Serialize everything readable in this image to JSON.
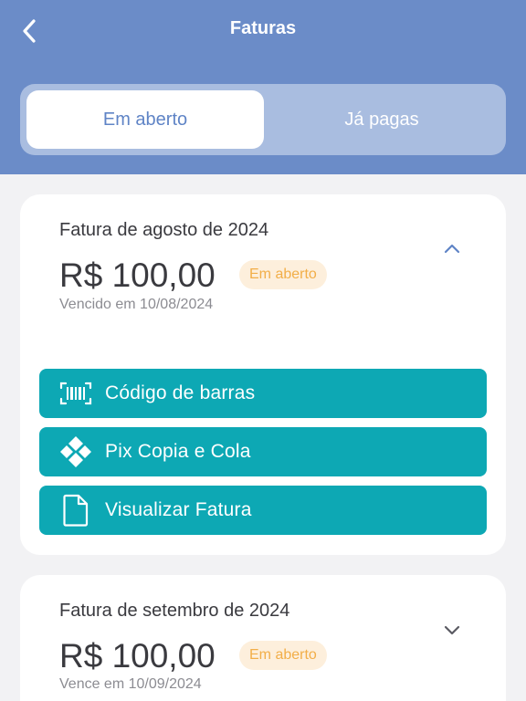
{
  "header": {
    "title": "Faturas",
    "back_icon": "chevron-left-icon"
  },
  "tabs": [
    {
      "label": "Em aberto",
      "active": true
    },
    {
      "label": "Já pagas",
      "active": false
    }
  ],
  "invoices": [
    {
      "title": "Fatura de agosto de 2024",
      "amount": "R$ 100,00",
      "status": "Em aberto",
      "due": "Vencido em 10/08/2024",
      "expanded": true,
      "chevron_icon": "chevron-up-icon",
      "actions": [
        {
          "label": "Código de barras",
          "icon": "barcode-icon"
        },
        {
          "label": "Pix Copia e Cola",
          "icon": "pix-icon"
        },
        {
          "label": "Visualizar Fatura",
          "icon": "document-icon"
        }
      ]
    },
    {
      "title": "Fatura de setembro de 2024",
      "amount": "R$ 100,00",
      "status": "Em aberto",
      "due": "Vence em 10/09/2024",
      "expanded": false,
      "chevron_icon": "chevron-down-icon"
    }
  ],
  "colors": {
    "header": "#6b8cc8",
    "segment_bg": "#a9bde0",
    "active_tab_text": "#5f84c6",
    "action_button": "#0da8b4",
    "badge_bg": "#fdefdc",
    "badge_text": "#f2ae48",
    "page_bg": "#f2f2f4"
  }
}
